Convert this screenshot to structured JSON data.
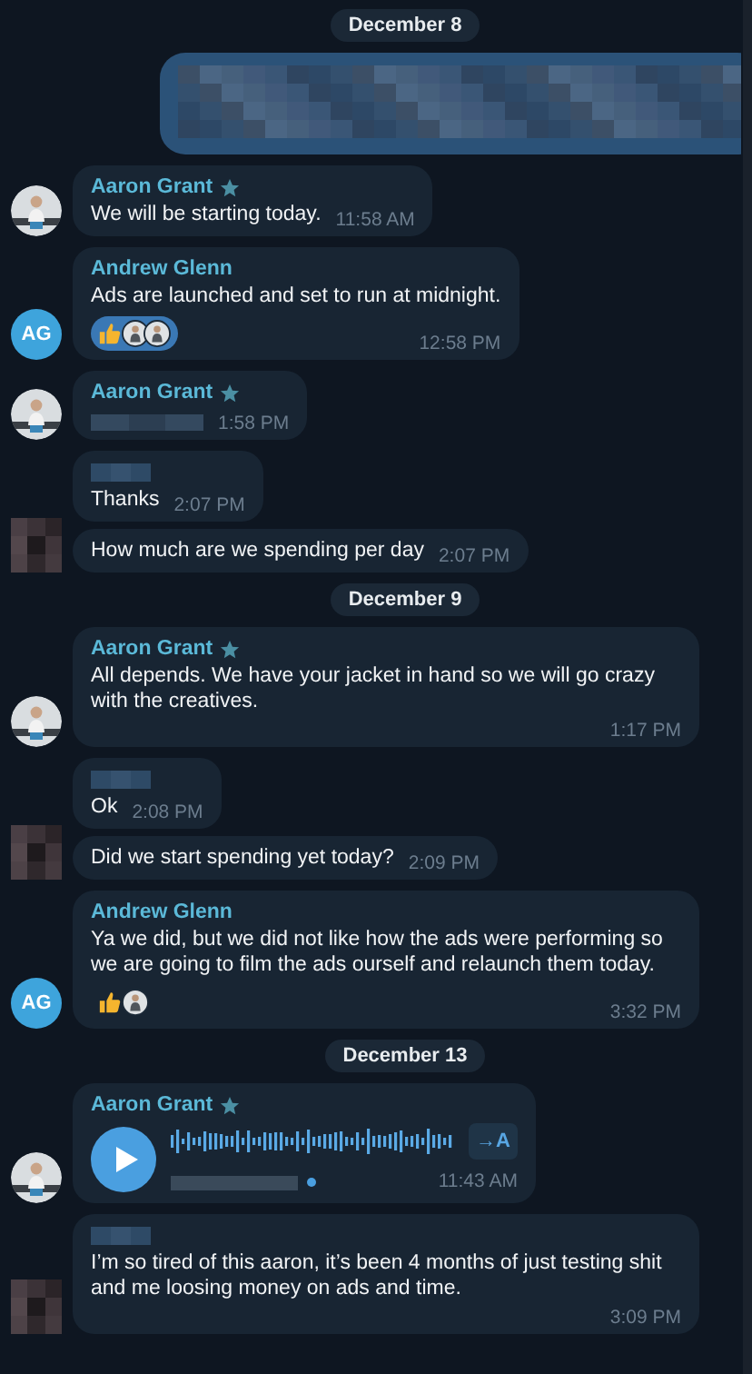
{
  "items": [
    {
      "kind": "date",
      "label": "December 8"
    },
    {
      "kind": "outgoing_redacted"
    },
    {
      "kind": "group",
      "avatar": {
        "kind": "photo"
      },
      "messages": [
        {
          "kind": "text",
          "sender": "Aaron Grant",
          "starred": true,
          "text": "We will be starting today.",
          "time": "11:58 AM"
        }
      ]
    },
    {
      "kind": "group",
      "avatar": {
        "kind": "initials",
        "initials": "AG"
      },
      "messages": [
        {
          "kind": "text",
          "sender": "Andrew Glenn",
          "starred": false,
          "text": "Ads are launched and set to run at midnight.",
          "time": "12:58 PM",
          "reactions": [
            {
              "selected": true,
              "users": [
                {
                  "kind": "photo"
                },
                {
                  "kind": "photo"
                }
              ]
            }
          ]
        }
      ]
    },
    {
      "kind": "group",
      "avatar": {
        "kind": "photo"
      },
      "messages": [
        {
          "kind": "text",
          "sender": "Aaron Grant",
          "starred": true,
          "text_redacted": true,
          "time": "1:58 PM"
        }
      ]
    },
    {
      "kind": "group",
      "avatar": {
        "kind": "redacted"
      },
      "messages": [
        {
          "kind": "text",
          "sender_redacted": true,
          "text": "Thanks",
          "time": "2:07 PM"
        },
        {
          "kind": "text",
          "text": "How much are we spending per day",
          "time": "2:07 PM"
        }
      ]
    },
    {
      "kind": "date",
      "label": "December 9"
    },
    {
      "kind": "group",
      "avatar": {
        "kind": "photo"
      },
      "messages": [
        {
          "kind": "text",
          "sender": "Aaron Grant",
          "starred": true,
          "text": "All depends. We have your jacket in hand so we will go crazy with the creatives.",
          "time": "1:17 PM"
        }
      ]
    },
    {
      "kind": "group",
      "avatar": {
        "kind": "redacted"
      },
      "messages": [
        {
          "kind": "text",
          "sender_redacted": true,
          "text": "Ok",
          "time": "2:08 PM"
        },
        {
          "kind": "text",
          "text": "Did we start spending yet today?",
          "time": "2:09 PM"
        }
      ]
    },
    {
      "kind": "group",
      "avatar": {
        "kind": "initials",
        "initials": "AG"
      },
      "messages": [
        {
          "kind": "text",
          "sender": "Andrew Glenn",
          "starred": false,
          "text": "Ya we did, but we did not like how the ads were performing so we are going to film the ads ourself and relaunch them today.",
          "time": "3:32 PM",
          "reactions": [
            {
              "selected": false,
              "users": [
                {
                  "kind": "photo"
                }
              ]
            }
          ]
        }
      ]
    },
    {
      "kind": "date",
      "label": "December 13"
    },
    {
      "kind": "group",
      "avatar": {
        "kind": "photo"
      },
      "messages": [
        {
          "kind": "voice",
          "sender": "Aaron Grant",
          "starred": true,
          "transcribe": "→A",
          "unread": true,
          "time": "11:43 AM"
        }
      ]
    },
    {
      "kind": "group",
      "avatar": {
        "kind": "redacted"
      },
      "messages": [
        {
          "kind": "text",
          "sender_redacted": true,
          "text": "I’m so tired of this aaron, it’s been 4 months of just testing shit and me loosing money on ads and time.",
          "time": "3:09 PM"
        }
      ]
    }
  ]
}
